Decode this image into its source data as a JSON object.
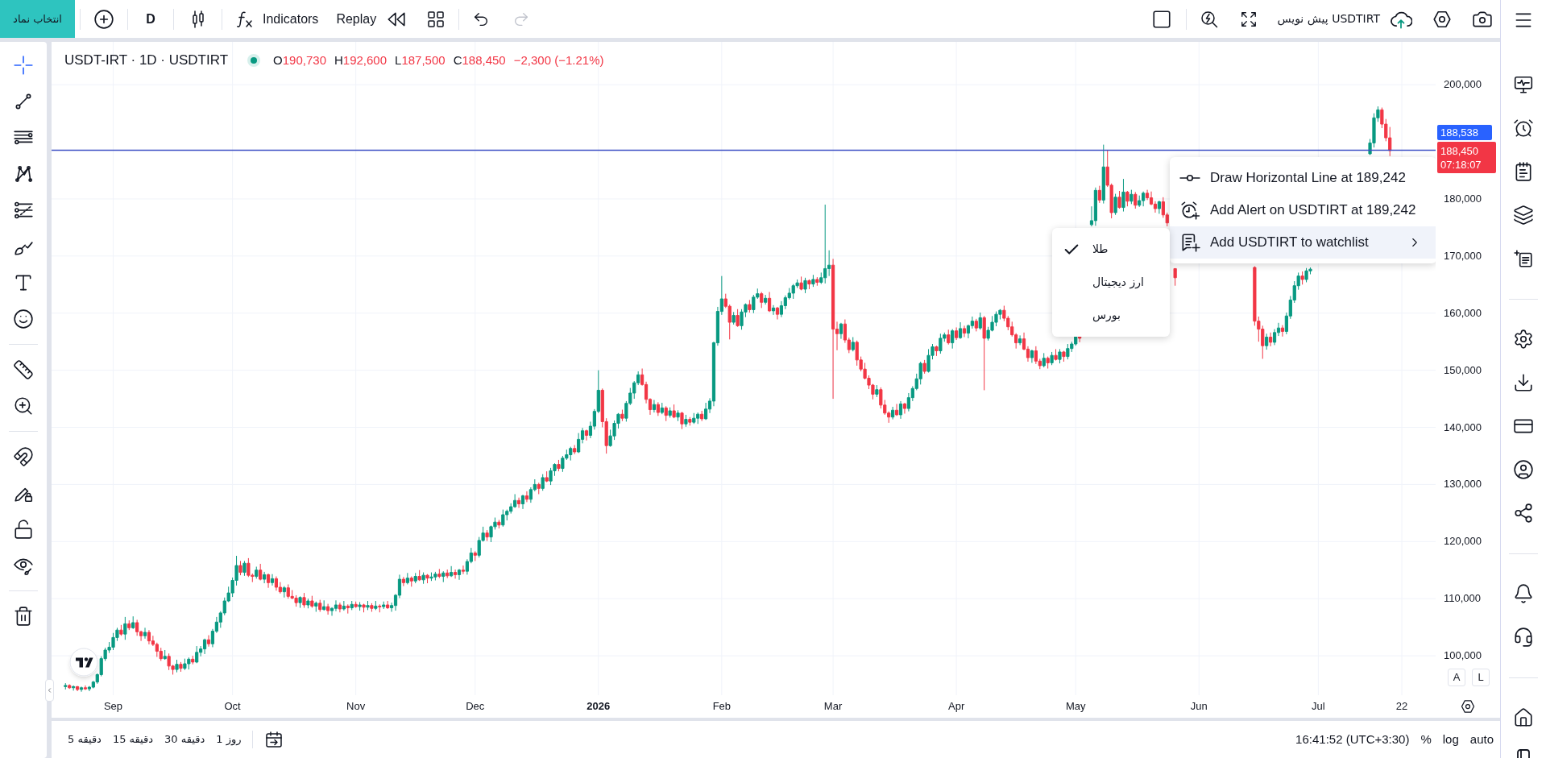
{
  "top_toolbar": {
    "symbol_button": "انتخاب نماد",
    "interval": "D",
    "indicators": "Indicators",
    "replay": "Replay",
    "redo": {
      "disabled": true
    },
    "layout_name": "پیش نویس USDTIRT"
  },
  "left_toolbar": {
    "groups": [
      {
        "tools": [
          {
            "kind": "crosshair",
            "selected": true
          },
          {
            "kind": "trend-line",
            "selected": false
          },
          {
            "kind": "horizontal-lines",
            "selected": false
          },
          {
            "kind": "pattern",
            "selected": false
          },
          {
            "kind": "levels",
            "selected": false
          },
          {
            "kind": "brush",
            "selected": false
          },
          {
            "kind": "text",
            "selected": false
          },
          {
            "kind": "emoji",
            "selected": false
          }
        ]
      },
      {
        "tools": [
          {
            "kind": "ruler",
            "selected": false
          },
          {
            "kind": "zoom",
            "selected": false
          }
        ]
      },
      {
        "tools": [
          {
            "kind": "magnet",
            "selected": false
          },
          {
            "kind": "lock-drawings",
            "selected": false
          },
          {
            "kind": "lock",
            "selected": false
          },
          {
            "kind": "visibility",
            "selected": false
          }
        ]
      },
      {
        "tools": [
          {
            "kind": "trash",
            "selected": false
          }
        ]
      }
    ]
  },
  "legend": {
    "title": "USDT-IRT · 1D · USDTIRT",
    "negative": true,
    "ohlc": [
      {
        "label": "O",
        "value": "190,730"
      },
      {
        "label": "H",
        "value": "192,600"
      },
      {
        "label": "L",
        "value": "187,500"
      },
      {
        "label": "C",
        "value": "188,450"
      }
    ],
    "change": "−2,300 (−1.21%)"
  },
  "chart": {
    "chart_data": {
      "type": "candlestick",
      "categories": [
        null,
        null,
        null,
        null,
        null,
        null,
        null,
        null,
        null,
        null,
        null,
        null,
        null,
        null,
        null,
        "Sep",
        null,
        null,
        null,
        null,
        null,
        null,
        null,
        null,
        null,
        null,
        null,
        null,
        null,
        null,
        null,
        null,
        null,
        null,
        null,
        null,
        null,
        null,
        null,
        null,
        null,
        null,
        null,
        null,
        null,
        "Oct",
        null,
        null,
        null,
        null,
        null,
        null,
        null,
        null,
        null,
        null,
        null,
        null,
        null,
        null,
        null,
        null,
        null,
        null,
        null,
        null,
        null,
        null,
        null,
        null,
        null,
        null,
        null,
        null,
        null,
        null,
        "Nov",
        null,
        null,
        null,
        null,
        null,
        null,
        null,
        null,
        null,
        null,
        null,
        null,
        null,
        null,
        null,
        null,
        null,
        null,
        null,
        null,
        null,
        null,
        null,
        null,
        null,
        null,
        null,
        null,
        null,
        "Dec",
        null,
        null,
        null,
        null,
        null,
        null,
        null,
        null,
        null,
        null,
        null,
        null,
        null,
        null,
        null,
        null,
        null,
        null,
        null,
        null,
        null,
        null,
        null,
        null,
        null,
        null,
        null,
        null,
        null,
        null,
        "2026",
        null,
        null,
        null,
        null,
        null,
        null,
        null,
        null,
        null,
        null,
        null,
        null,
        null,
        null,
        null,
        null,
        null,
        null,
        null,
        null,
        null,
        null,
        null,
        null,
        null,
        null,
        null,
        null,
        null,
        null,
        "Feb",
        null,
        null,
        null,
        null,
        null,
        null,
        null,
        null,
        null,
        null,
        null,
        null,
        null,
        null,
        null,
        null,
        null,
        null,
        null,
        null,
        null,
        null,
        null,
        null,
        null,
        null,
        null,
        "Mar",
        null,
        null,
        null,
        null,
        null,
        null,
        null,
        null,
        null,
        null,
        null,
        null,
        null,
        null,
        null,
        null,
        null,
        null,
        null,
        null,
        null,
        null,
        null,
        null,
        null,
        null,
        null,
        null,
        null,
        null,
        "Apr",
        null,
        null,
        null,
        null,
        null,
        null,
        null,
        null,
        null,
        null,
        null,
        null,
        null,
        null,
        null,
        null,
        null,
        null,
        null,
        null,
        null,
        null,
        null,
        null,
        null,
        null,
        null,
        null,
        null,
        "May",
        null,
        null,
        null,
        null,
        null,
        null,
        null,
        null,
        null,
        null,
        null,
        null,
        null,
        null,
        null,
        null,
        null,
        null,
        null,
        null,
        null,
        null,
        null,
        null,
        null,
        null,
        null,
        null,
        null,
        null,
        "Jun",
        null,
        null,
        null,
        null,
        null,
        null,
        null,
        null,
        null,
        null,
        null,
        null,
        null,
        null,
        null,
        null,
        null,
        null,
        null,
        null,
        null,
        null,
        null,
        null,
        null,
        null,
        null,
        null,
        null,
        "Jul",
        null,
        null,
        null,
        null,
        null,
        null,
        null,
        null,
        null,
        null,
        null,
        null,
        null,
        null,
        null,
        null,
        null,
        null,
        null,
        null,
        "22",
        null,
        null,
        null,
        null,
        null,
        null,
        null,
        null
      ],
      "ohlc": [
        null,
        null,
        null,
        [
          94600,
          95200,
          94100,
          94800
        ],
        [
          94800,
          95000,
          94200,
          94400
        ],
        [
          94400,
          94800,
          93900,
          94600
        ],
        [
          94600,
          94700,
          93800,
          94100
        ],
        [
          94100,
          94600,
          93700,
          94400
        ],
        [
          94400,
          94800,
          94000,
          94200
        ],
        [
          94200,
          94700,
          93800,
          94500
        ],
        [
          94500,
          95600,
          94300,
          95400
        ],
        [
          95400,
          96900,
          95100,
          96700
        ],
        [
          96700,
          99900,
          96400,
          99500
        ],
        [
          99500,
          101400,
          99100,
          101000
        ],
        [
          101000,
          102400,
          100500,
          101500
        ],
        [
          101500,
          104000,
          101000,
          103200
        ],
        [
          103200,
          104900,
          102600,
          104500
        ],
        [
          104500,
          105400,
          103500,
          103800
        ],
        [
          103800,
          106800,
          102800,
          105600
        ],
        [
          105600,
          106200,
          104500,
          104900
        ],
        [
          104900,
          106900,
          104700,
          105800
        ],
        [
          105800,
          106300,
          103500,
          104200
        ],
        [
          104200,
          104400,
          102600,
          103500
        ],
        [
          103500,
          104900,
          103000,
          104100
        ],
        [
          104100,
          104500,
          102000,
          102600
        ],
        [
          102600,
          103500,
          101700,
          102000
        ],
        [
          102000,
          102300,
          99800,
          100800
        ],
        [
          100800,
          101400,
          99100,
          99500
        ],
        [
          99500,
          101000,
          99300,
          99900
        ],
        [
          99900,
          100400,
          97500,
          98200
        ],
        [
          98200,
          98400,
          96700,
          97600
        ],
        [
          97600,
          99300,
          97100,
          98500
        ],
        [
          98500,
          98900,
          97200,
          97800
        ],
        [
          97800,
          99500,
          97500,
          98600
        ],
        [
          98600,
          99700,
          97600,
          99400
        ],
        [
          99400,
          100000,
          98500,
          98900
        ],
        [
          98900,
          101700,
          98700,
          100600
        ],
        [
          100600,
          101700,
          99900,
          101200
        ],
        [
          101200,
          103000,
          100300,
          102800
        ],
        [
          102800,
          103600,
          101600,
          102100
        ],
        [
          102100,
          104700,
          101500,
          104300
        ],
        [
          104300,
          106800,
          104000,
          105900
        ],
        [
          105900,
          107800,
          104900,
          107500
        ],
        [
          107500,
          110200,
          107100,
          109600
        ],
        [
          109600,
          112100,
          109400,
          111000
        ],
        [
          111000,
          113700,
          110300,
          113200
        ],
        [
          113200,
          117500,
          112300,
          115800
        ],
        [
          115800,
          116600,
          114100,
          114600
        ],
        [
          114600,
          116600,
          114000,
          116200
        ],
        [
          116200,
          117100,
          113800,
          114100
        ],
        [
          114100,
          114400,
          112900,
          113900
        ],
        [
          113900,
          115600,
          113500,
          115000
        ],
        [
          115000,
          116100,
          113200,
          113400
        ],
        [
          113400,
          114700,
          112700,
          114200
        ],
        [
          114200,
          114400,
          111900,
          112800
        ],
        [
          112800,
          114300,
          112300,
          113500
        ],
        [
          113500,
          113900,
          111400,
          112000
        ],
        [
          112000,
          112900,
          110900,
          111200
        ],
        [
          111200,
          112200,
          110200,
          111900
        ],
        [
          111900,
          112500,
          110000,
          110400
        ],
        [
          110400,
          111500,
          109900,
          110100
        ],
        [
          110100,
          110600,
          108600,
          109300
        ],
        [
          109300,
          110400,
          108400,
          110200
        ],
        [
          110200,
          111000,
          108400,
          108900
        ],
        [
          108900,
          110000,
          108300,
          109600
        ],
        [
          109600,
          110500,
          108400,
          108700
        ],
        [
          108700,
          109500,
          107700,
          109200
        ],
        [
          109200,
          109800,
          107700,
          108100
        ],
        [
          108100,
          109700,
          107900,
          108600
        ],
        [
          108600,
          109100,
          107200,
          107900
        ],
        [
          107900,
          108500,
          107000,
          108300
        ],
        [
          108300,
          109700,
          107800,
          108900
        ],
        [
          108900,
          109300,
          107600,
          108200
        ],
        [
          108200,
          109600,
          107900,
          108700
        ],
        [
          108700,
          109000,
          107400,
          108400
        ],
        [
          108400,
          109600,
          108000,
          109000
        ],
        [
          109000,
          109500,
          108400,
          108600
        ],
        [
          108600,
          109400,
          107900,
          108900
        ],
        [
          108900,
          109100,
          107600,
          108500
        ],
        [
          108500,
          109600,
          108000,
          108800
        ],
        [
          108800,
          109200,
          107700,
          108300
        ],
        [
          108300,
          109600,
          108000,
          108700
        ],
        [
          108700,
          109000,
          107600,
          108600
        ],
        [
          108600,
          109500,
          108200,
          108900
        ],
        [
          108900,
          109600,
          108200,
          108400
        ],
        [
          108400,
          109300,
          107700,
          108800
        ],
        [
          108800,
          110800,
          107900,
          110600
        ],
        [
          110600,
          114200,
          110100,
          113400
        ],
        [
          113400,
          113800,
          112200,
          112800
        ],
        [
          112800,
          114500,
          112500,
          113600
        ],
        [
          113600,
          113900,
          112100,
          113100
        ],
        [
          113100,
          114500,
          112700,
          113900
        ],
        [
          113900,
          115000,
          113100,
          113300
        ],
        [
          113300,
          114600,
          112600,
          114100
        ],
        [
          114100,
          114300,
          112700,
          113600
        ],
        [
          113600,
          114600,
          113100,
          113800
        ],
        [
          113800,
          114700,
          113200,
          114300
        ],
        [
          114300,
          115200,
          113600,
          113900
        ],
        [
          113900,
          114800,
          112900,
          114500
        ],
        [
          114500,
          115100,
          113600,
          114000
        ],
        [
          114000,
          115700,
          113800,
          114600
        ],
        [
          114600,
          115100,
          113500,
          114200
        ],
        [
          114200,
          115200,
          113300,
          115000
        ],
        [
          115000,
          115800,
          114300,
          114800
        ],
        [
          114800,
          116900,
          114200,
          116500
        ],
        [
          116500,
          118900,
          116200,
          118000
        ],
        [
          118000,
          118300,
          116600,
          117600
        ],
        [
          117600,
          120800,
          117200,
          120200
        ],
        [
          120200,
          122600,
          120000,
          121500
        ],
        [
          121500,
          122000,
          120100,
          120800
        ],
        [
          120800,
          122800,
          119900,
          122600
        ],
        [
          122600,
          124200,
          122100,
          123400
        ],
        [
          123400,
          123800,
          122300,
          122900
        ],
        [
          122900,
          125600,
          122600,
          124700
        ],
        [
          124700,
          125600,
          123700,
          125300
        ],
        [
          125300,
          126700,
          124900,
          126100
        ],
        [
          126100,
          128300,
          125900,
          127200
        ],
        [
          127200,
          127700,
          125900,
          126600
        ],
        [
          126600,
          128200,
          125700,
          128000
        ],
        [
          128000,
          128800,
          126900,
          127400
        ],
        [
          127400,
          129500,
          126800,
          129100
        ],
        [
          129100,
          130900,
          128800,
          130000
        ],
        [
          130000,
          130300,
          128300,
          129300
        ],
        [
          129300,
          131800,
          128900,
          131200
        ],
        [
          131200,
          132300,
          130400,
          130600
        ],
        [
          130600,
          132900,
          129900,
          132400
        ],
        [
          132400,
          133700,
          131500,
          133500
        ],
        [
          133500,
          134300,
          132300,
          132800
        ],
        [
          132800,
          135000,
          132200,
          134600
        ],
        [
          134600,
          136100,
          134300,
          135200
        ],
        [
          135200,
          136600,
          134200,
          136300
        ],
        [
          136300,
          136900,
          135300,
          135700
        ],
        [
          135700,
          139000,
          135500,
          137900
        ],
        [
          137900,
          139900,
          137200,
          139400
        ],
        [
          139400,
          139600,
          137700,
          138600
        ],
        [
          138600,
          141000,
          138100,
          140200
        ],
        [
          140200,
          143200,
          139600,
          142800
        ],
        [
          142800,
          150000,
          142500,
          146500
        ],
        [
          146500,
          146800,
          140000,
          141000
        ],
        [
          141000,
          141600,
          135400,
          136800
        ],
        [
          136800,
          139600,
          136600,
          138500
        ],
        [
          138500,
          141200,
          137800,
          140700
        ],
        [
          140700,
          142500,
          139800,
          142300
        ],
        [
          142300,
          143100,
          141100,
          141600
        ],
        [
          141600,
          144600,
          141000,
          144200
        ],
        [
          144200,
          146900,
          143900,
          146000
        ],
        [
          146000,
          148100,
          145000,
          147800
        ],
        [
          147800,
          149800,
          147400,
          149200
        ],
        [
          149200,
          150300,
          147300,
          147500
        ],
        [
          147500,
          148000,
          144200,
          144900
        ],
        [
          144900,
          145100,
          142200,
          143100
        ],
        [
          143100,
          144800,
          142600,
          144000
        ],
        [
          144000,
          144400,
          142000,
          142600
        ],
        [
          142600,
          144300,
          142300,
          143400
        ],
        [
          143400,
          143700,
          141100,
          142100
        ],
        [
          142100,
          143500,
          141700,
          142900
        ],
        [
          142900,
          144000,
          141600,
          141800
        ],
        [
          141800,
          143000,
          141100,
          142500
        ],
        [
          142500,
          142700,
          139700,
          140600
        ],
        [
          140600,
          142200,
          140100,
          141400
        ],
        [
          141400,
          141800,
          140300,
          140900
        ],
        [
          140900,
          142500,
          140600,
          141600
        ],
        [
          141600,
          142600,
          140600,
          142300
        ],
        [
          142300,
          142900,
          141100,
          141500
        ],
        [
          141500,
          144300,
          141300,
          143200
        ],
        [
          143200,
          145100,
          142500,
          144600
        ],
        [
          144600,
          155000,
          143700,
          154800
        ],
        [
          154800,
          161100,
          154300,
          160300
        ],
        [
          160300,
          166500,
          159700,
          162500
        ],
        [
          162500,
          163400,
          160900,
          161200
        ],
        [
          161200,
          161500,
          155400,
          158400
        ],
        [
          158400,
          160200,
          158000,
          159600
        ],
        [
          159600,
          160700,
          157600,
          157800
        ],
        [
          157800,
          160700,
          157100,
          160200
        ],
        [
          160200,
          161700,
          159300,
          161500
        ],
        [
          161500,
          162300,
          160100,
          160600
        ],
        [
          160600,
          163200,
          160000,
          162800
        ],
        [
          162800,
          164300,
          162500,
          163400
        ],
        [
          163400,
          163700,
          160900,
          161900
        ],
        [
          161900,
          163200,
          161500,
          162600
        ],
        [
          162600,
          163700,
          160200,
          160400
        ],
        [
          160400,
          161400,
          159700,
          160900
        ],
        [
          160900,
          161100,
          158900,
          159800
        ],
        [
          159800,
          162100,
          159300,
          161300
        ],
        [
          161300,
          163100,
          160700,
          162700
        ],
        [
          162700,
          164400,
          162400,
          163500
        ],
        [
          163500,
          165100,
          162500,
          164800
        ],
        [
          164800,
          165900,
          164400,
          165300
        ],
        [
          165300,
          166400,
          164000,
          164200
        ],
        [
          164200,
          166200,
          163500,
          165700
        ],
        [
          165700,
          165900,
          164200,
          165100
        ],
        [
          165100,
          166700,
          164600,
          165900
        ],
        [
          165900,
          166300,
          164800,
          165400
        ],
        [
          165400,
          167100,
          165100,
          166200
        ],
        [
          166200,
          179000,
          165200,
          167800
        ],
        [
          167800,
          171000,
          166500,
          168400
        ],
        [
          168400,
          169500,
          145000,
          157200
        ],
        [
          157200,
          158500,
          153500,
          156400
        ],
        [
          156400,
          158300,
          155500,
          158100
        ],
        [
          158100,
          158900,
          154800,
          155300
        ],
        [
          155300,
          155700,
          153000,
          153600
        ],
        [
          153600,
          155800,
          153300,
          154900
        ],
        [
          154900,
          155200,
          150800,
          151800
        ],
        [
          151800,
          152400,
          149800,
          150200
        ],
        [
          150200,
          151300,
          148400,
          148600
        ],
        [
          148600,
          149100,
          146700,
          147400
        ],
        [
          147400,
          147600,
          144900,
          145800
        ],
        [
          145800,
          147400,
          145300,
          146600
        ],
        [
          146600,
          147000,
          143300,
          143900
        ],
        [
          143900,
          144800,
          142200,
          142500
        ],
        [
          142500,
          142800,
          140800,
          141800
        ],
        [
          141800,
          143600,
          141400,
          143000
        ],
        [
          143000,
          144100,
          142000,
          142200
        ],
        [
          142200,
          144600,
          141500,
          144100
        ],
        [
          144100,
          144300,
          142400,
          143300
        ],
        [
          143300,
          146000,
          142800,
          145200
        ],
        [
          145200,
          147200,
          144600,
          146800
        ],
        [
          146800,
          149400,
          146500,
          148500
        ],
        [
          148500,
          151500,
          147500,
          151200
        ],
        [
          151200,
          151800,
          149400,
          149800
        ],
        [
          149800,
          153700,
          149600,
          152600
        ],
        [
          152600,
          154600,
          151900,
          154100
        ],
        [
          154100,
          154300,
          152500,
          153400
        ],
        [
          153400,
          156400,
          152900,
          155600
        ],
        [
          155600,
          156600,
          155000,
          156200
        ],
        [
          156200,
          157100,
          154500,
          154800
        ],
        [
          154800,
          157200,
          153800,
          156900
        ],
        [
          156900,
          157500,
          155300,
          155700
        ],
        [
          155700,
          158400,
          155500,
          157300
        ],
        [
          157300,
          157800,
          155800,
          156500
        ],
        [
          156500,
          158000,
          155600,
          157800
        ],
        [
          157800,
          159400,
          157300,
          158600
        ],
        [
          158600,
          159000,
          156800,
          157400
        ],
        [
          157400,
          160100,
          157100,
          159200
        ],
        [
          159200,
          159500,
          146500,
          155600
        ],
        [
          155600,
          157600,
          155200,
          157000
        ],
        [
          157000,
          159500,
          156800,
          158400
        ],
        [
          158400,
          160300,
          157700,
          159800
        ],
        [
          159800,
          160700,
          158900,
          160500
        ],
        [
          160500,
          161300,
          158600,
          159100
        ],
        [
          159100,
          159500,
          157000,
          157600
        ],
        [
          157600,
          158500,
          155900,
          156200
        ],
        [
          156200,
          156500,
          153800,
          154800
        ],
        [
          154800,
          156100,
          154400,
          155500
        ],
        [
          155500,
          156600,
          153500,
          153700
        ],
        [
          153700,
          154200,
          151500,
          152200
        ],
        [
          152200,
          153600,
          151300,
          153400
        ],
        [
          153400,
          154200,
          151100,
          151600
        ],
        [
          151600,
          152000,
          150200,
          150800
        ],
        [
          150800,
          153000,
          150500,
          152100
        ],
        [
          152100,
          152400,
          150300,
          151300
        ],
        [
          151300,
          153200,
          150900,
          152600
        ],
        [
          152600,
          153700,
          151700,
          151900
        ],
        [
          151900,
          153700,
          151200,
          153200
        ],
        [
          153200,
          153400,
          151500,
          152400
        ],
        [
          152400,
          154600,
          151900,
          153800
        ],
        [
          153800,
          155000,
          153200,
          154600
        ],
        [
          154600,
          156000,
          154300,
          155900
        ],
        [
          155900,
          156000,
          154900,
          155600
        ],
        null,
        null,
        [
          175500,
          178700,
          175200,
          176200
        ],
        [
          176200,
          182000,
          175300,
          181500
        ],
        [
          181500,
          182300,
          179300,
          179800
        ],
        [
          179800,
          189500,
          179200,
          185600
        ],
        [
          185600,
          188600,
          182100,
          182400
        ],
        [
          182400,
          182700,
          176600,
          177600
        ],
        [
          177600,
          180900,
          177200,
          180300
        ],
        [
          180300,
          181400,
          178300,
          178500
        ],
        [
          178500,
          183500,
          177800,
          181200
        ],
        [
          181200,
          181400,
          178700,
          179600
        ],
        [
          179600,
          181600,
          179100,
          180800
        ],
        [
          180800,
          181200,
          178300,
          178900
        ],
        [
          178900,
          180600,
          178600,
          179700
        ],
        [
          179700,
          181300,
          178700,
          181000
        ],
        [
          181000,
          181600,
          179800,
          180200
        ],
        [
          180200,
          181300,
          178900,
          179100
        ],
        [
          179100,
          179600,
          177600,
          178300
        ],
        [
          178300,
          179700,
          177400,
          179500
        ],
        [
          179500,
          180300,
          176700,
          177200
        ],
        [
          177200,
          177600,
          175200,
          175800
        ],
        null,
        [
          167800,
          167800,
          164800,
          166200
        ],
        null,
        null,
        null,
        null,
        null,
        null,
        null,
        null,
        null,
        null,
        null,
        null,
        null,
        null,
        null,
        null,
        null,
        null,
        null,
        [
          168000,
          168200,
          157800,
          158600
        ],
        [
          158600,
          159400,
          155000,
          157200
        ],
        [
          157200,
          157800,
          152000,
          154300
        ],
        [
          154300,
          156400,
          153600,
          155800
        ],
        [
          155800,
          156600,
          154200,
          154900
        ],
        [
          154900,
          157200,
          154400,
          156600
        ],
        [
          156600,
          158300,
          156000,
          157400
        ],
        [
          157400,
          157900,
          155900,
          156800
        ],
        [
          156800,
          160100,
          156300,
          159500
        ],
        [
          159500,
          163000,
          159000,
          162300
        ],
        [
          162300,
          165600,
          161800,
          164800
        ],
        [
          164800,
          167100,
          164100,
          166500
        ],
        [
          166500,
          167300,
          165000,
          165900
        ],
        [
          165900,
          167900,
          165400,
          167400
        ],
        [
          167400,
          168000,
          166800,
          167700
        ],
        null,
        null,
        null,
        null,
        null,
        null,
        null,
        null,
        null,
        null,
        null,
        null,
        null,
        null,
        [
          187900,
          190500,
          187700,
          189800
        ],
        [
          189800,
          195000,
          189000,
          194200
        ],
        [
          194200,
          196200,
          193500,
          195600
        ],
        [
          195600,
          196000,
          192400,
          193100
        ],
        [
          193100,
          194000,
          190100,
          190700
        ],
        [
          190700,
          192600,
          187500,
          188450
        ],
        null,
        null,
        null,
        null,
        null,
        null,
        null,
        null,
        null,
        null,
        null
      ],
      "ylim": [
        93100,
        207500
      ],
      "grid": true,
      "yticks": [
        {
          "value": 200000,
          "label": "200,000"
        },
        {
          "value": 180000,
          "label": "180,000"
        },
        {
          "value": 170000,
          "label": "170,000"
        },
        {
          "value": 160000,
          "label": "160,000"
        },
        {
          "value": 150000,
          "label": "150,000"
        },
        {
          "value": 140000,
          "label": "140,000"
        },
        {
          "value": 130000,
          "label": "130,000"
        },
        {
          "value": 120000,
          "label": "120,000"
        },
        {
          "value": 110000,
          "label": "110,000"
        },
        {
          "value": 100000,
          "label": "100,000"
        }
      ],
      "ref_lines": [
        {
          "axis": "y",
          "value": 188538,
          "label": "188,538"
        }
      ]
    }
  },
  "time_axis": {
    "ticks": [
      {
        "bold": false
      },
      {
        "bold": false
      },
      {
        "bold": false
      },
      {
        "bold": false
      },
      {
        "bold": true
      },
      {
        "bold": false
      },
      {
        "bold": false
      },
      {
        "bold": false
      },
      {
        "bold": false
      },
      {
        "bold": false
      },
      {
        "bold": false
      },
      {
        "bold": false
      }
    ]
  },
  "price_axis": {
    "last_price": "188,450",
    "countdown": "07:18:07",
    "buttons": [
      "A",
      "L"
    ]
  },
  "context_menu": {
    "items": [
      {
        "kind": "horizontal-line",
        "label": "Draw Horizontal Line at 189,242",
        "expanded": false
      },
      {
        "kind": "alert",
        "label": "Add Alert on USDTIRT at 189,242",
        "expanded": false
      },
      {
        "kind": "watchlist",
        "label": "Add USDTIRT to watchlist",
        "expanded": true,
        "submenu": [
          {
            "label": "طلا",
            "selected": true
          },
          {
            "label": "ارز دیجیتال",
            "selected": false
          },
          {
            "label": "بورس",
            "selected": false
          }
        ]
      }
    ]
  },
  "bottom_bar": {
    "intervals": [
      "1 روز",
      "30 دقیقه",
      "15 دقیقه",
      "5 دقیقه"
    ],
    "time": "16:41:52 (UTC+3:30)",
    "scale_options": [
      "%",
      "log",
      "auto"
    ]
  }
}
